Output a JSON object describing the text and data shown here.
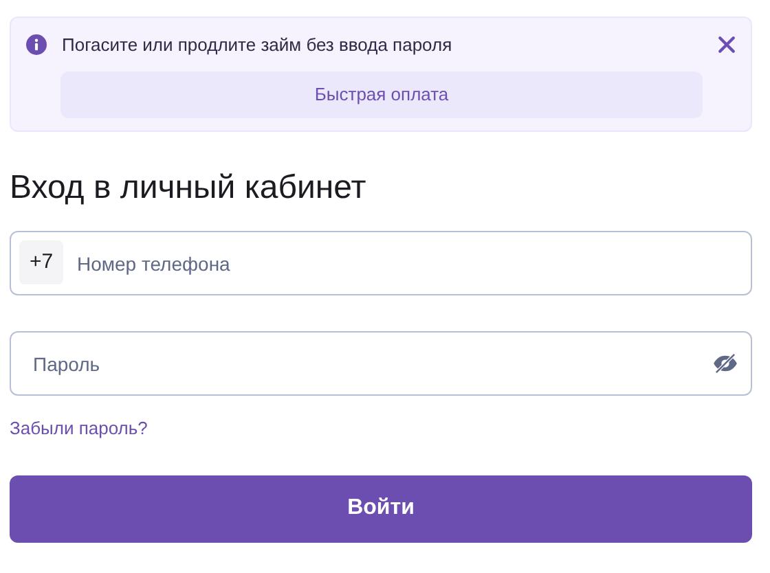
{
  "banner": {
    "message": "Погасите или продлите займ без ввода пароля",
    "button": "Быстрая оплата"
  },
  "title": "Вход в личный кабинет",
  "phone": {
    "prefix": "+7",
    "placeholder": "Номер телефона"
  },
  "password": {
    "placeholder": "Пароль"
  },
  "forgot_link": "Забыли пароль?",
  "submit": "Войти"
}
